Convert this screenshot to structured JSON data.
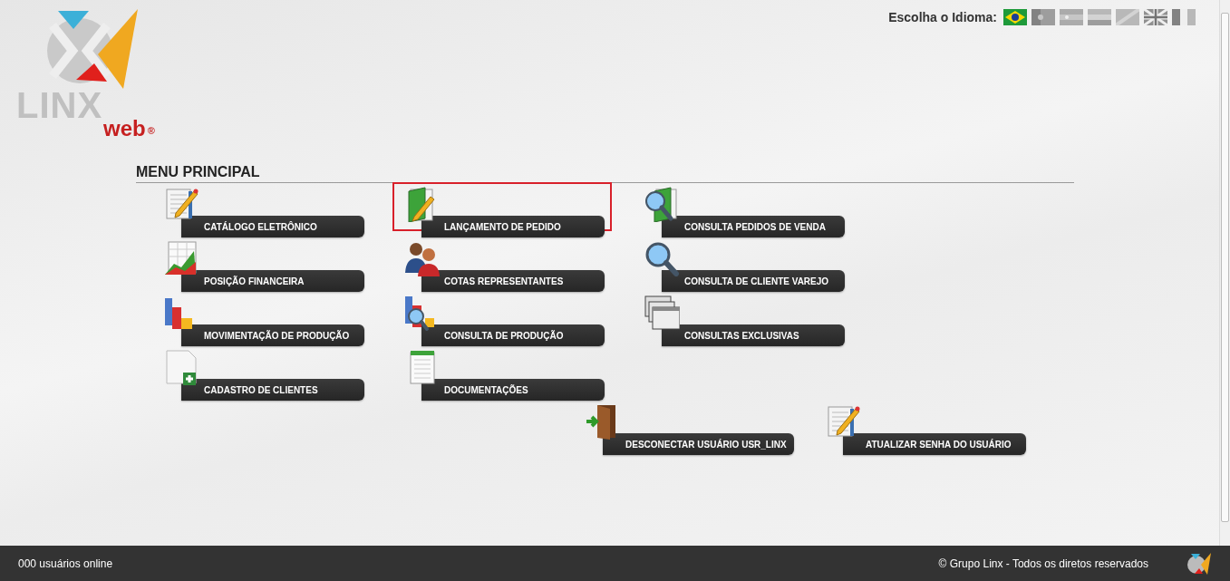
{
  "header": {
    "logo": {
      "wordmark": "LINX",
      "suffix": "web",
      "registered": "®"
    },
    "language_label": "Escolha o Idioma:",
    "languages": [
      {
        "kind": "br",
        "selected": true
      },
      {
        "kind": "emblem",
        "selected": false
      },
      {
        "kind": "stripes-star",
        "selected": false
      },
      {
        "kind": "stripes",
        "selected": false
      },
      {
        "kind": "diagonal",
        "selected": false
      },
      {
        "kind": "gb",
        "selected": false
      },
      {
        "kind": "vertical",
        "selected": false
      }
    ]
  },
  "menu": {
    "title": "MENU PRINCIPAL",
    "rows": [
      [
        {
          "label": "CATÁLOGO ELETRÔNICO",
          "kind": "notepad",
          "selected": false
        },
        {
          "label": "LANÇAMENTO DE PEDIDO",
          "kind": "order",
          "selected": true
        },
        {
          "label": "CONSULTA PEDIDOS DE VENDA",
          "kind": "orderquery",
          "selected": false
        }
      ],
      [
        {
          "label": "POSIÇÃO FINANCEIRA",
          "kind": "chart",
          "selected": false
        },
        {
          "label": "COTAS REPRESENTANTES",
          "kind": "people",
          "selected": false
        },
        {
          "label": "CONSULTA DE CLIENTE VAREJO",
          "kind": "search",
          "selected": false
        }
      ],
      [
        {
          "label": "MOVIMENTAÇÃO DE PRODUÇÃO",
          "kind": "bars",
          "selected": false
        },
        {
          "label": "CONSULTA DE PRODUÇÃO",
          "kind": "barsquery",
          "selected": false
        },
        {
          "label": "CONSULTAS EXCLUSIVAS",
          "kind": "windows",
          "selected": false
        }
      ],
      [
        {
          "label": "CADASTRO DE CLIENTES",
          "kind": "register",
          "selected": false
        },
        {
          "label": "DOCUMENTAÇÕES",
          "kind": "notebook",
          "selected": false
        }
      ]
    ],
    "account_actions": [
      {
        "label": "DESCONECTAR USUÁRIO USR_LINX",
        "kind": "door",
        "selected": false
      },
      {
        "label": "ATUALIZAR SENHA DO USUÁRIO",
        "kind": "notepad",
        "selected": false
      }
    ]
  },
  "footer": {
    "online": "000 usuários online",
    "copyright": "© Grupo Linx - Todos os diretos reservados"
  }
}
